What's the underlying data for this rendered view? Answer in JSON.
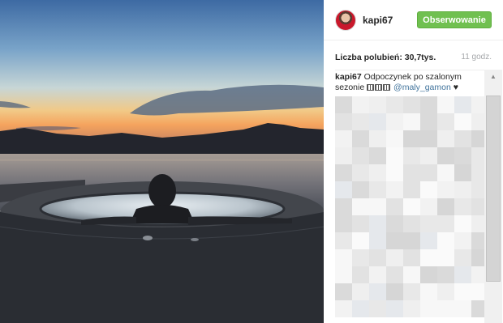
{
  "header": {
    "username": "kapi67",
    "follow_label": "Obserwowanie"
  },
  "stats": {
    "likes_label": "Liczba polubień: 30,7tys.",
    "time_ago": "11 godz."
  },
  "caption": {
    "username": "kapi67",
    "text": "Odpoczynek po szalonym sezonie",
    "mention": "@maly_gamon",
    "heart": "♥"
  },
  "colors": {
    "follow_button": "#70c050",
    "mention_link": "#3f729b"
  },
  "icons": {
    "scroll_up": "scroll-up-arrow-icon",
    "heart": "heart-icon"
  }
}
